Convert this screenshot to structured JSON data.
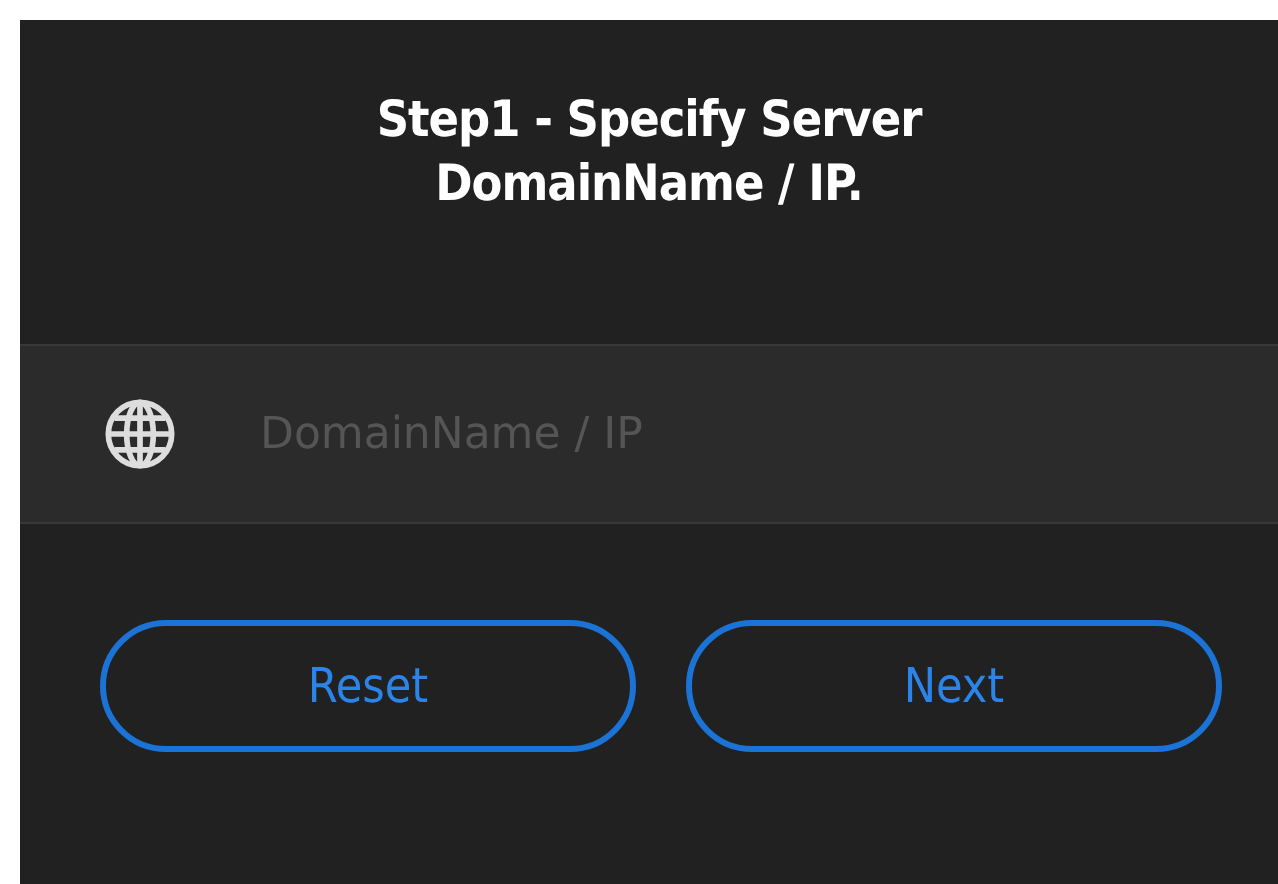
{
  "title": "Step1 - Specify Server\nDomainName / IP.",
  "field": {
    "placeholder": "DomainName / IP"
  },
  "buttons": [
    {
      "label": "Reset"
    },
    {
      "label": "Next"
    }
  ]
}
